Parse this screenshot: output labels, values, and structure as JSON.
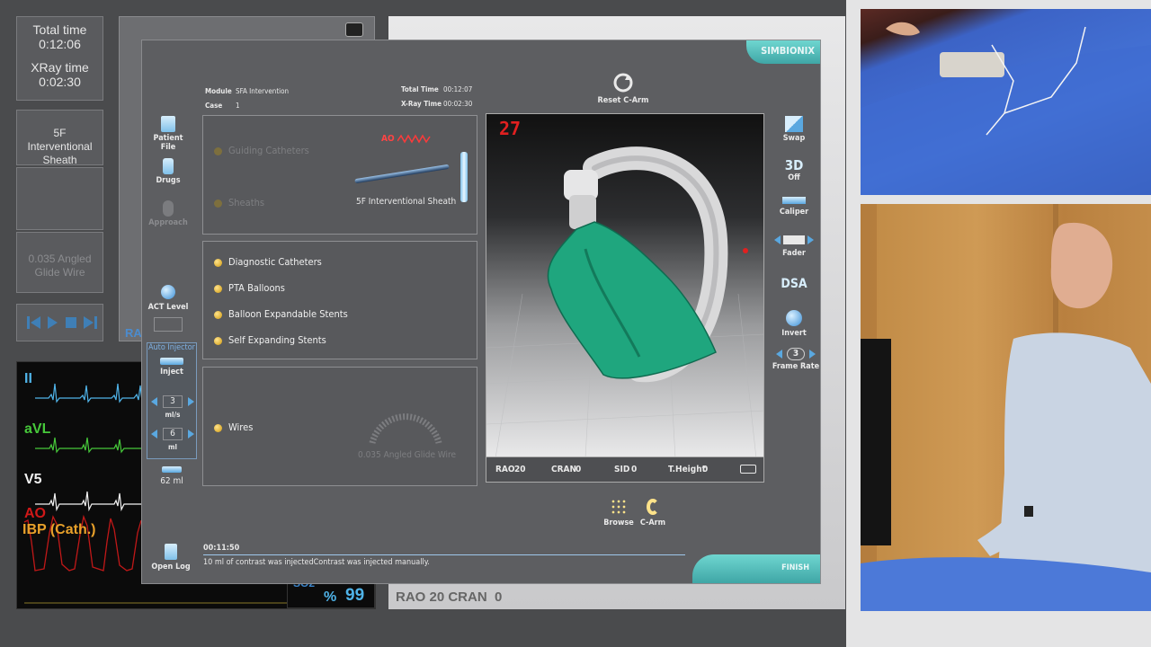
{
  "left_panel": {
    "total_time_label": "Total time",
    "total_time_value": "0:12:06",
    "xray_time_label": "XRay time",
    "xray_time_value": "0:02:30",
    "device_primary": "5F Interventional Sheath",
    "device_secondary": "0.035 Angled Glide Wire",
    "partial_label": "RA"
  },
  "monitor": {
    "traces": [
      {
        "label": "II",
        "color": "#4fb3e8"
      },
      {
        "label": "aVL",
        "color": "#46c83a"
      },
      {
        "label": "V5",
        "color": "#f2f2f2"
      },
      {
        "label": "AO",
        "color": "#d01818"
      }
    ],
    "ibp_label": "IBP (Cath.)",
    "ibp_color": "#e8a12a",
    "spo2_label": "SO2",
    "spo2_unit": "%",
    "spo2_value": "99"
  },
  "bottom_caption": "RAO 20 CRAN  0",
  "sim": {
    "brand": "SIMBIONIX",
    "module_label": "Module",
    "module_value": "SFA Intervention",
    "case_label": "Case",
    "case_value": "1",
    "total_time_label": "Total Time",
    "total_time_value": "00:12:07",
    "xray_time_label": "X-Ray Time",
    "xray_time_value": "00:02:30",
    "reset_carm_label": "Reset C-Arm",
    "left_tools": [
      {
        "label": "Patient File",
        "icon": "folder-icon"
      },
      {
        "label": "Drugs",
        "icon": "vial-icon"
      },
      {
        "label": "Approach",
        "icon": "approach-icon"
      }
    ],
    "act_level_label": "ACT Level",
    "auto_injector_label": "Auto Injector",
    "inject_label": "Inject",
    "rate_value": "3",
    "rate_unit": "ml/s",
    "volume_value": "6",
    "volume_unit": "ml",
    "total_volume": "62 ml",
    "open_log_label": "Open Log",
    "section1": {
      "items": [
        "Guiding Catheters",
        "Sheaths"
      ],
      "ao_label": "AO",
      "selected_device": "5F Interventional Sheath"
    },
    "section2": {
      "items": [
        "Diagnostic Catheters",
        "PTA Balloons",
        "Balloon Expandable Stents",
        "Self Expanding Stents"
      ]
    },
    "section3": {
      "items": [
        "Wires"
      ],
      "selected_device": "0.035 Angled Glide Wire"
    },
    "viewport": {
      "frame_counter": "27",
      "rao_label": "RAO",
      "rao_value": "20",
      "cran_label": "CRAN",
      "cran_value": "0",
      "sid_label": "SID",
      "sid_value": "0",
      "theight_label": "T.Height",
      "theight_value": "0"
    },
    "right_tools": {
      "swap": "Swap",
      "three_d": "3D",
      "three_d_state": "Off",
      "caliper": "Caliper",
      "fader": "Fader",
      "dsa": "DSA",
      "invert": "Invert",
      "frame_rate_value": "3",
      "frame_rate": "Frame Rate"
    },
    "browse_label": "Browse",
    "carm_label": "C-Arm",
    "log_time": "00:11:50",
    "log_message": "10 ml of contrast was injectedContrast was injected manually.",
    "finish_label": "FINISH"
  }
}
